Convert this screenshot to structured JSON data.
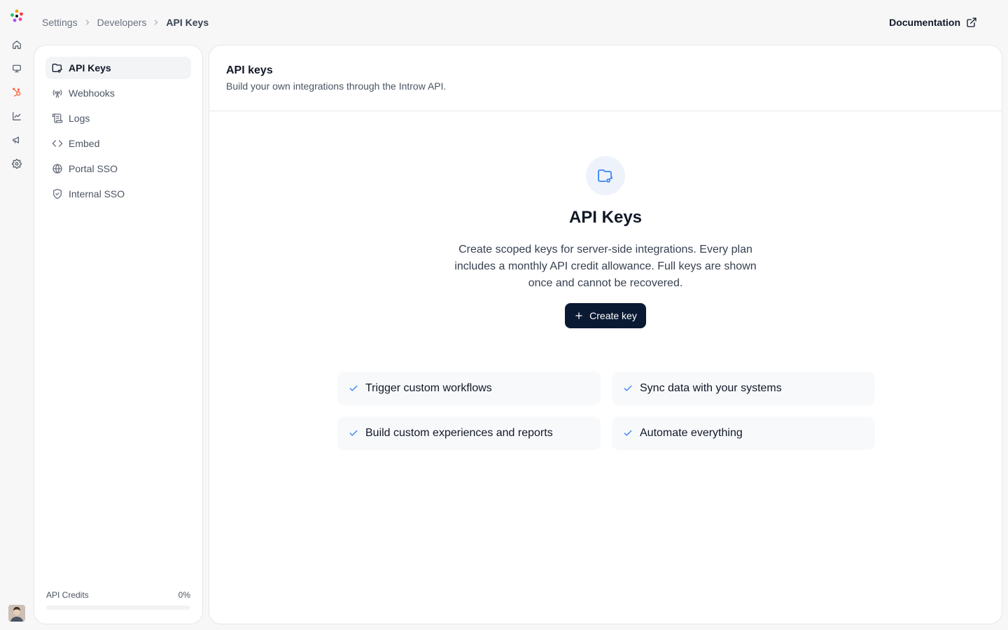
{
  "breadcrumb": {
    "items": [
      "Settings",
      "Developers",
      "API Keys"
    ]
  },
  "header_link": {
    "label": "Documentation",
    "icon": "external-link-icon"
  },
  "rail": {
    "icons": [
      "home-icon",
      "monitor-icon",
      "hubspot-icon",
      "chart-icon",
      "megaphone-icon",
      "gear-icon"
    ],
    "accent": "#ff5c35"
  },
  "sidebar": {
    "items": [
      {
        "label": "API Keys",
        "icon": "folder-key-icon",
        "active": true
      },
      {
        "label": "Webhooks",
        "icon": "radio-tower-icon",
        "active": false
      },
      {
        "label": "Logs",
        "icon": "scroll-icon",
        "active": false
      },
      {
        "label": "Embed",
        "icon": "code-icon",
        "active": false
      },
      {
        "label": "Portal SSO",
        "icon": "globe-lock-icon",
        "active": false
      },
      {
        "label": "Internal SSO",
        "icon": "shield-icon",
        "active": false
      }
    ],
    "credits": {
      "label": "API Credits",
      "value": "0%",
      "fraction": 0
    }
  },
  "main": {
    "title": "API keys",
    "subtitle": "Build your own integrations through the Introw API.",
    "empty": {
      "heading": "API Keys",
      "description": "Create scoped keys for server-side integrations. Every plan includes a monthly API credit allowance. Full keys are shown once and cannot be recovered.",
      "button_label": "Create key"
    },
    "features": [
      "Trigger custom workflows",
      "Sync data with your systems",
      "Build custom experiences and reports",
      "Automate everything"
    ]
  },
  "colors": {
    "primary_button": "#0b1a33",
    "accent_blue": "#3b82f6",
    "active_nav_bg": "#f3f4f6"
  }
}
